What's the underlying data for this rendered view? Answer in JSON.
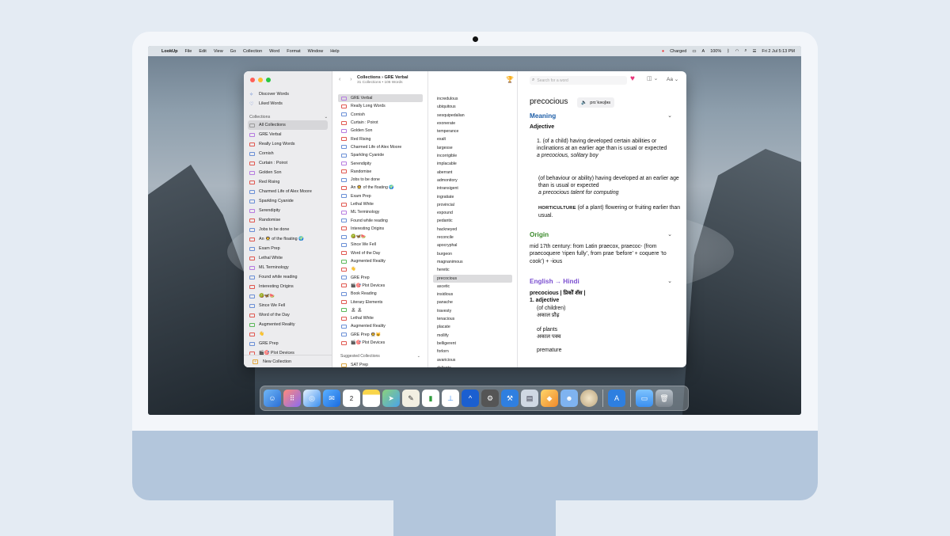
{
  "menubar": {
    "items": [
      "LookUp",
      "File",
      "Edit",
      "View",
      "Go",
      "Collection",
      "Word",
      "Format",
      "Window",
      "Help"
    ],
    "status": [
      "Charged",
      "100%",
      "Fri 2 Jul  5:13 PM"
    ]
  },
  "sidebar": {
    "top_items": [
      {
        "label": "Discover Words",
        "icon": "sparkle-icon"
      },
      {
        "label": "Liked Words",
        "icon": "heart-outline-icon"
      }
    ],
    "collections_header": "Collections",
    "items": [
      "All Collections",
      "GRE Verbal",
      "Really Long Words",
      "Cornish",
      "Curtain : Poirot",
      "Golden Son",
      "Red Rising",
      "Charmed Life of Alex Moore",
      "Sparkling Cyanide",
      "Serendipity",
      "Randomise",
      "Jobs to be done",
      "An 👨‍🚀 of the floating 🌍",
      "Exam Prep",
      "Lethal White",
      "ML Terminology",
      "Found while reading",
      "Interesting Origins",
      "🥝🦋🍉",
      "Since We Fell",
      "Word of the Day",
      "Augmented Reality",
      "👋",
      "GRE Prep",
      "🎬🎯 Plot Devices"
    ],
    "new_collection": "New Collection"
  },
  "collections_column": {
    "title": "Collections › GRE Verbal",
    "subtitle": "31 Collections • 106 Words",
    "items": [
      "GRE Verbal",
      "Really Long Words",
      "Cornish",
      "Curtain : Poirot",
      "Golden Son",
      "Red Rising",
      "Charmed Life of Alex Moore",
      "Sparkling Cyanide",
      "Serendipity",
      "Randomise",
      "Jobs to be done",
      "An 👨‍🚀 of the floating 🌍",
      "Exam Prep",
      "Lethal White",
      "ML Terminology",
      "Found while reading",
      "Interesting Origins",
      "🥝🦋🍉",
      "Since We Fell",
      "Word of the Day",
      "Augmented Reality",
      "👋",
      "GRE Prep",
      "🎬🎯 Plot Devices",
      "Book Reading",
      "Literary Elements",
      "🏝 🏝",
      "Lethal White",
      "Augmented Reality",
      "GRE Prep 👨‍🚀😺",
      "🎬🎯 Plot Devices"
    ],
    "suggested_header": "Suggested Collections",
    "suggested_first": "SAT Prep"
  },
  "words_column": {
    "items": [
      "incredulous",
      "ubiquitous",
      "sesquipedalian",
      "exonerate",
      "temperance",
      "exalt",
      "largesse",
      "incorrigible",
      "implacable",
      "aberrant",
      "admonitory",
      "intransigent",
      "ingratiate",
      "provincial",
      "expound",
      "pedantic",
      "hackneyed",
      "reconcile",
      "apocryphal",
      "burgeon",
      "magnanimous",
      "heretic",
      "precocious",
      "ascetic",
      "insidious",
      "panache",
      "travesty",
      "tenacious",
      "placate",
      "mollify",
      "belligerent",
      "forlorn",
      "avaricious",
      "delicate"
    ],
    "selected": "precocious"
  },
  "detail": {
    "search_placeholder": "Search for a word",
    "font_button": "Aa",
    "headword": "precocious",
    "pronunciation": "prɪˈkəʊʃəs",
    "meaning_title": "Meaning",
    "pos": "Adjective",
    "def1": "1. (of a child) having developed certain abilities or inclinations at an earlier age than is usual or expected",
    "ex1": "a precocious, solitary boy",
    "def2": "(of behaviour or ability) having developed at an earlier age than is usual or expected",
    "ex2": "a precocious talent for computing",
    "def3_label": "HORTICULTURE",
    "def3": " (of a plant) flowering or fruiting earlier than usual.",
    "origin_title": "Origin",
    "origin_text": "mid 17th century: from Latin praecox, praecoc- (from praecoquere ‘ripen fully’, from prae ‘before’ + coquere ‘to cook’) + -ious",
    "hindi_title": "English → Hindi",
    "hindi_head": "precocious | प्रिकोॅ शॅस |",
    "hindi_pos": "1. adjective",
    "hindi_s1": "(of children)",
    "hindi_s1_trans": "अकाल प्रौढ़",
    "hindi_s2": "of plants",
    "hindi_s2_trans": "अकाल पक्व",
    "hindi_s3": "premature"
  },
  "colors": {
    "accent_blue": "#1f5fa8",
    "origin_green": "#3a8a2a",
    "hindi_purple": "#7b4fd0",
    "heart_pink": "#e8337a"
  }
}
